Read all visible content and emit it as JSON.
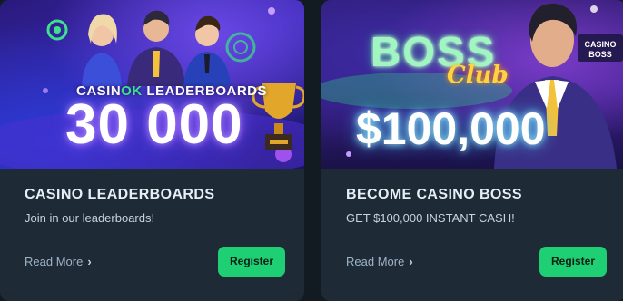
{
  "cards": [
    {
      "banner": {
        "brand_prefix": "CASIN",
        "brand_accent": "OK",
        "title_suffix": " LEADERBOARDS",
        "prize": "30 000"
      },
      "title": "CASINO LEADERBOARDS",
      "subtitle": "Join in our leaderboards!",
      "read_more_label": "Read More",
      "register_label": "Register"
    },
    {
      "banner": {
        "logo_main": "BOSS",
        "logo_script": "Club",
        "sign": "CASINO\nBOSS",
        "prize": "$100,000"
      },
      "title": "BECOME CASINO BOSS",
      "subtitle": "GET $100,000 INSTANT CASH!",
      "read_more_label": "Read More",
      "register_label": "Register"
    }
  ],
  "colors": {
    "page_bg": "#121a22",
    "card_bg": "#1e2a35",
    "accent_green": "#1fcf74",
    "brand_green": "#3ee08a"
  },
  "icons": {
    "read_more": "chevron-right-icon",
    "trophy": "trophy-icon",
    "chips": "casino-chip-icon"
  }
}
